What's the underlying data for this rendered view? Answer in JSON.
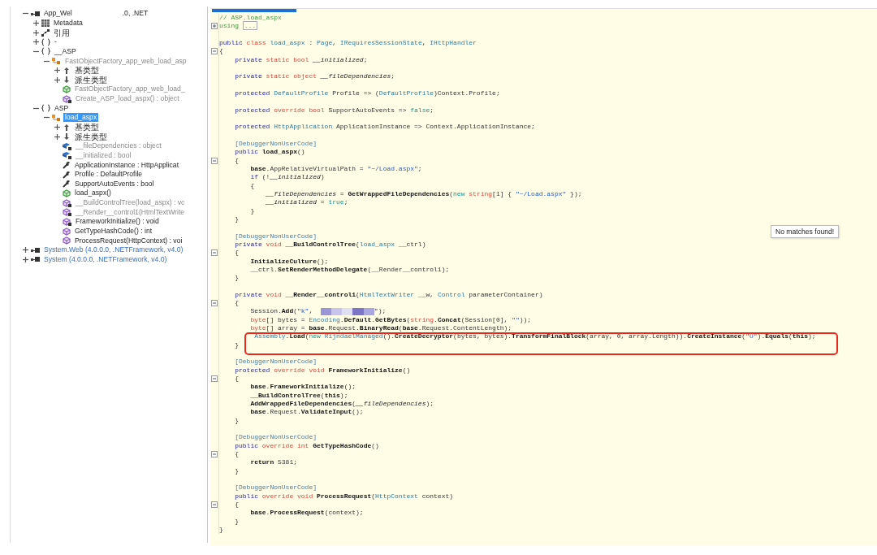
{
  "tree": [
    {
      "kind": "assembly",
      "label": "App_Wel",
      "tail": ".0, .NET",
      "dimmed": false,
      "expanded": true,
      "selected": false,
      "children": [
        {
          "kind": "metadata",
          "label": "Metadata",
          "dimmed": false,
          "expanded": false,
          "selected": false
        },
        {
          "kind": "references",
          "label": "引用",
          "dimmed": false,
          "expanded": false,
          "selected": false
        },
        {
          "kind": "namespace",
          "label": "-",
          "dimmed": false,
          "expanded": false,
          "selected": false
        },
        {
          "kind": "namespace",
          "label": "__ASP",
          "dimmed": false,
          "expanded": true,
          "selected": false,
          "children": [
            {
              "kind": "class",
              "label": "FastObjectFactory_app_web_load_asp",
              "dimmed": true,
              "expanded": true,
              "selected": false,
              "children": [
                {
                  "kind": "base-types",
                  "label": "基类型",
                  "dimmed": false,
                  "expanded": false,
                  "selected": false
                },
                {
                  "kind": "derived-types",
                  "label": "派生类型",
                  "dimmed": false,
                  "expanded": false,
                  "selected": false
                },
                {
                  "kind": "constructor",
                  "label": "FastObjectFactory_app_web_load_",
                  "dimmed": true,
                  "selected": false
                },
                {
                  "kind": "method-private",
                  "label": "Create_ASP_load_aspx() : object",
                  "dimmed": true,
                  "selected": false
                }
              ]
            }
          ]
        },
        {
          "kind": "namespace",
          "label": "ASP",
          "dimmed": false,
          "expanded": true,
          "selected": false,
          "children": [
            {
              "kind": "class",
              "label": "load_aspx",
              "dimmed": false,
              "expanded": true,
              "selected": true,
              "children": [
                {
                  "kind": "base-types",
                  "label": "基类型",
                  "dimmed": false,
                  "expanded": false,
                  "selected": false
                },
                {
                  "kind": "derived-types",
                  "label": "派生类型",
                  "dimmed": false,
                  "expanded": false,
                  "selected": false
                },
                {
                  "kind": "field",
                  "label": "__fileDependencies : object",
                  "dimmed": true,
                  "selected": false
                },
                {
                  "kind": "field",
                  "label": "__initialized : bool",
                  "dimmed": true,
                  "selected": false
                },
                {
                  "kind": "property",
                  "label": "ApplicationInstance : HttpApplicat",
                  "dimmed": false,
                  "selected": false
                },
                {
                  "kind": "property",
                  "label": "Profile : DefaultProfile",
                  "dimmed": false,
                  "selected": false
                },
                {
                  "kind": "property",
                  "label": "SupportAutoEvents : bool",
                  "dimmed": false,
                  "selected": false
                },
                {
                  "kind": "constructor",
                  "label": "load_aspx()",
                  "dimmed": false,
                  "selected": false
                },
                {
                  "kind": "method-private",
                  "label": "__BuildControlTree(load_aspx) : vc",
                  "dimmed": true,
                  "selected": false
                },
                {
                  "kind": "method-private",
                  "label": "__Render__control1(HtmlTextWrite",
                  "dimmed": true,
                  "selected": false
                },
                {
                  "kind": "method-protected",
                  "label": "FrameworkInitialize() : void",
                  "dimmed": false,
                  "selected": false
                },
                {
                  "kind": "method",
                  "label": "GetTypeHashCode() : int",
                  "dimmed": false,
                  "selected": false
                },
                {
                  "kind": "method",
                  "label": "ProcessRequest(HttpContext) : voi",
                  "dimmed": false,
                  "selected": false
                }
              ]
            }
          ]
        }
      ]
    },
    {
      "kind": "reference-assembly",
      "label": "System.Web (4.0.0.0, .NETFramework, v4.0)",
      "dimmed": false,
      "expanded": false,
      "selected": false
    },
    {
      "kind": "reference-assembly",
      "label": "System (4.0.0.0, .NETFramework, v4.0)",
      "dimmed": false,
      "expanded": false,
      "selected": false
    }
  ],
  "code": {
    "search_popup": "No matches found!",
    "lines": [
      {
        "boxed": false,
        "t": [
          {
            "kind": "comment",
            "text": "// ASP.load_aspx"
          }
        ]
      },
      {
        "boxed": false,
        "fold_expanded": false,
        "t": [
          {
            "kind": "comment",
            "text": "using "
          },
          {
            "kind": "collapsed",
            "text": "..."
          }
        ]
      },
      {
        "boxed": false
      },
      {
        "boxed": false,
        "t": [
          {
            "kind": "keyword",
            "text": "public"
          },
          {
            "kind": "modifier",
            "text": " class"
          },
          {
            "kind": "type",
            "text": " load_aspx"
          },
          {
            "kind": "plain",
            "text": " : "
          },
          {
            "kind": "type",
            "text": "Page"
          },
          {
            "kind": "plain",
            "text": ", "
          },
          {
            "kind": "type",
            "text": "IRequiresSessionState"
          },
          {
            "kind": "plain",
            "text": ", "
          },
          {
            "kind": "type",
            "text": "IHttpHandler"
          }
        ]
      },
      {
        "boxed": false,
        "fold_expanded": true,
        "t": [
          {
            "kind": "plain",
            "text": "{"
          }
        ]
      },
      {
        "boxed": false,
        "t": [
          {
            "kind": "keyword",
            "text": "private"
          },
          {
            "kind": "modifier",
            "text": " static bool"
          },
          {
            "kind": "field",
            "text": " __initialized"
          },
          {
            "kind": "plain",
            "text": ";"
          }
        ]
      },
      {
        "boxed": false
      },
      {
        "boxed": false,
        "t": [
          {
            "kind": "keyword",
            "text": "private"
          },
          {
            "kind": "modifier",
            "text": " static object"
          },
          {
            "kind": "field",
            "text": " __fileDependencies"
          },
          {
            "kind": "plain",
            "text": ";"
          }
        ]
      },
      {
        "boxed": false
      },
      {
        "boxed": false,
        "t": [
          {
            "kind": "keyword",
            "text": "protected"
          },
          {
            "kind": "type",
            "text": " DefaultProfile"
          },
          {
            "kind": "plain",
            "text": " Profile => ("
          },
          {
            "kind": "type",
            "text": "DefaultProfile"
          },
          {
            "kind": "plain",
            "text": ")Context.Profile;"
          }
        ]
      },
      {
        "boxed": false
      },
      {
        "boxed": false,
        "t": [
          {
            "kind": "keyword",
            "text": "protected"
          },
          {
            "kind": "modifier",
            "text": " override bool"
          },
          {
            "kind": "plain",
            "text": " SupportAutoEvents => "
          },
          {
            "kind": "literal",
            "text": "false"
          },
          {
            "kind": "plain",
            "text": ";"
          }
        ]
      },
      {
        "boxed": false
      },
      {
        "boxed": false,
        "t": [
          {
            "kind": "keyword",
            "text": "protected"
          },
          {
            "kind": "type",
            "text": " HttpApplication"
          },
          {
            "kind": "plain",
            "text": " ApplicationInstance => Context.ApplicationInstance;"
          }
        ]
      },
      {
        "boxed": false
      },
      {
        "boxed": false,
        "t": [
          {
            "kind": "attribute",
            "text": "[DebuggerNonUserCode]"
          }
        ]
      },
      {
        "boxed": false,
        "t": [
          {
            "kind": "keyword",
            "text": "public"
          },
          {
            "kind": "method",
            "text": " load_aspx"
          },
          {
            "kind": "plain",
            "text": "()"
          }
        ]
      },
      {
        "boxed": false,
        "fold_expanded": true,
        "t": [
          {
            "kind": "plain",
            "text": "{"
          }
        ]
      },
      {
        "boxed": false,
        "t": [
          {
            "kind": "method",
            "text": "base"
          },
          {
            "kind": "plain",
            "text": ".AppRelativeVirtualPath = "
          },
          {
            "kind": "string",
            "text": "\"~/Load.aspx\""
          },
          {
            "kind": "plain",
            "text": ";"
          }
        ]
      },
      {
        "boxed": false,
        "t": [
          {
            "kind": "keyword",
            "text": "if"
          },
          {
            "kind": "plain",
            "text": " (!"
          },
          {
            "kind": "field",
            "text": "__initialized"
          },
          {
            "kind": "plain",
            "text": ")"
          }
        ]
      },
      {
        "boxed": false,
        "t": [
          {
            "kind": "plain",
            "text": "{"
          }
        ]
      },
      {
        "boxed": false,
        "t": [
          {
            "kind": "field",
            "text": "__fileDependencies"
          },
          {
            "kind": "plain",
            "text": " = "
          },
          {
            "kind": "method",
            "text": "GetWrappedFileDependencies"
          },
          {
            "kind": "plain",
            "text": "("
          },
          {
            "kind": "literal",
            "text": "new"
          },
          {
            "kind": "modifier",
            "text": " string"
          },
          {
            "kind": "plain",
            "text": "[1] { "
          },
          {
            "kind": "string",
            "text": "\"~/Load.aspx\""
          },
          {
            "kind": "plain",
            "text": " });"
          }
        ]
      },
      {
        "boxed": false,
        "t": [
          {
            "kind": "field",
            "text": "__initialized"
          },
          {
            "kind": "plain",
            "text": " = "
          },
          {
            "kind": "literal",
            "text": "true"
          },
          {
            "kind": "plain",
            "text": ";"
          }
        ]
      },
      {
        "boxed": false,
        "t": [
          {
            "kind": "plain",
            "text": "}"
          }
        ]
      },
      {
        "boxed": false,
        "t": [
          {
            "kind": "plain",
            "text": "}"
          }
        ]
      },
      {
        "boxed": false
      },
      {
        "boxed": false,
        "t": [
          {
            "kind": "attribute",
            "text": "[DebuggerNonUserCode]"
          }
        ]
      },
      {
        "boxed": false,
        "t": [
          {
            "kind": "keyword",
            "text": "private"
          },
          {
            "kind": "modifier",
            "text": " void"
          },
          {
            "kind": "method",
            "text": " __BuildControlTree"
          },
          {
            "kind": "plain",
            "text": "("
          },
          {
            "kind": "type",
            "text": "load_aspx"
          },
          {
            "kind": "plain",
            "text": " __ctrl)"
          }
        ]
      },
      {
        "boxed": false,
        "fold_expanded": true,
        "t": [
          {
            "kind": "plain",
            "text": "{"
          }
        ]
      },
      {
        "boxed": false,
        "t": [
          {
            "kind": "method",
            "text": "InitializeCulture"
          },
          {
            "kind": "plain",
            "text": "();"
          }
        ]
      },
      {
        "boxed": false,
        "t": [
          {
            "kind": "plain",
            "text": "__ctrl."
          },
          {
            "kind": "method",
            "text": "SetRenderMethodDelegate"
          },
          {
            "kind": "plain",
            "text": "(__Render__control1);"
          }
        ]
      },
      {
        "boxed": false,
        "t": [
          {
            "kind": "plain",
            "text": "}"
          }
        ]
      },
      {
        "boxed": false
      },
      {
        "boxed": false,
        "t": [
          {
            "kind": "keyword",
            "text": "private"
          },
          {
            "kind": "modifier",
            "text": " void"
          },
          {
            "kind": "method",
            "text": " __Render__control1"
          },
          {
            "kind": "plain",
            "text": "("
          },
          {
            "kind": "type",
            "text": "HtmlTextWriter"
          },
          {
            "kind": "plain",
            "text": " __w, "
          },
          {
            "kind": "type",
            "text": "Control"
          },
          {
            "kind": "plain",
            "text": " parameterContainer)"
          }
        ]
      },
      {
        "boxed": false,
        "fold_expanded": true,
        "t": [
          {
            "kind": "plain",
            "text": "{"
          }
        ]
      },
      {
        "boxed": false,
        "t": [
          {
            "kind": "plain",
            "text": "Session."
          },
          {
            "kind": "method",
            "text": "Add"
          },
          {
            "kind": "plain",
            "text": "("
          },
          {
            "kind": "string",
            "text": "\"k\""
          },
          {
            "kind": "plain",
            "text": ",  "
          },
          {
            "kind": "redacted"
          },
          {
            "kind": "plain",
            "text": "\");"
          }
        ]
      },
      {
        "boxed": false,
        "t": [
          {
            "kind": "modifier",
            "text": "byte"
          },
          {
            "kind": "plain",
            "text": "[] bytes = "
          },
          {
            "kind": "type",
            "text": "Encoding"
          },
          {
            "kind": "plain",
            "text": "."
          },
          {
            "kind": "method",
            "text": "Default"
          },
          {
            "kind": "plain",
            "text": "."
          },
          {
            "kind": "method",
            "text": "GetBytes"
          },
          {
            "kind": "plain",
            "text": "("
          },
          {
            "kind": "modifier",
            "text": "string"
          },
          {
            "kind": "plain",
            "text": "."
          },
          {
            "kind": "method",
            "text": "Concat"
          },
          {
            "kind": "plain",
            "text": "(Session[0], "
          },
          {
            "kind": "string",
            "text": "\"\""
          },
          {
            "kind": "plain",
            "text": "));"
          }
        ]
      },
      {
        "boxed": false,
        "t": [
          {
            "kind": "modifier",
            "text": "byte"
          },
          {
            "kind": "plain",
            "text": "[] array = "
          },
          {
            "kind": "method",
            "text": "base"
          },
          {
            "kind": "plain",
            "text": ".Request."
          },
          {
            "kind": "method",
            "text": "BinaryRead"
          },
          {
            "kind": "plain",
            "text": "("
          },
          {
            "kind": "method",
            "text": "base"
          },
          {
            "kind": "plain",
            "text": ".Request.ContentLength);"
          }
        ]
      },
      {
        "boxed": true,
        "t": [
          {
            "kind": "type",
            "text": "Assembly"
          },
          {
            "kind": "plain",
            "text": "."
          },
          {
            "kind": "method",
            "text": "Load"
          },
          {
            "kind": "plain",
            "text": "("
          },
          {
            "kind": "literal",
            "text": "new"
          },
          {
            "kind": "type",
            "text": " RijndaelManaged"
          },
          {
            "kind": "plain",
            "text": "()."
          },
          {
            "kind": "method",
            "text": "CreateDecryptor"
          },
          {
            "kind": "plain",
            "text": "(bytes, bytes)."
          },
          {
            "kind": "method",
            "text": "TransformFinalBlock"
          },
          {
            "kind": "plain",
            "text": "(array, 0, array.Length))."
          },
          {
            "kind": "method",
            "text": "CreateInstance"
          },
          {
            "kind": "plain",
            "text": "("
          },
          {
            "kind": "string",
            "text": "\"U\""
          },
          {
            "kind": "plain",
            "text": ")."
          },
          {
            "kind": "method",
            "text": "Equals"
          },
          {
            "kind": "plain",
            "text": "("
          },
          {
            "kind": "method",
            "text": "this"
          },
          {
            "kind": "plain",
            "text": ");"
          }
        ]
      },
      {
        "boxed": false,
        "t": [
          {
            "kind": "plain",
            "text": "}"
          }
        ]
      },
      {
        "boxed": false
      },
      {
        "boxed": false,
        "t": [
          {
            "kind": "attribute",
            "text": "[DebuggerNonUserCode]"
          }
        ]
      },
      {
        "boxed": false,
        "t": [
          {
            "kind": "keyword",
            "text": "protected"
          },
          {
            "kind": "modifier",
            "text": " override void"
          },
          {
            "kind": "method",
            "text": " FrameworkInitialize"
          },
          {
            "kind": "plain",
            "text": "()"
          }
        ]
      },
      {
        "boxed": false,
        "fold_expanded": true,
        "t": [
          {
            "kind": "plain",
            "text": "{"
          }
        ]
      },
      {
        "boxed": false,
        "t": [
          {
            "kind": "method",
            "text": "base"
          },
          {
            "kind": "plain",
            "text": "."
          },
          {
            "kind": "method",
            "text": "FrameworkInitialize"
          },
          {
            "kind": "plain",
            "text": "();"
          }
        ]
      },
      {
        "boxed": false,
        "t": [
          {
            "kind": "method",
            "text": "__BuildControlTree"
          },
          {
            "kind": "plain",
            "text": "("
          },
          {
            "kind": "method",
            "text": "this"
          },
          {
            "kind": "plain",
            "text": ");"
          }
        ]
      },
      {
        "boxed": false,
        "t": [
          {
            "kind": "method",
            "text": "AddWrappedFileDependencies"
          },
          {
            "kind": "plain",
            "text": "("
          },
          {
            "kind": "field",
            "text": "__fileDependencies"
          },
          {
            "kind": "plain",
            "text": ");"
          }
        ]
      },
      {
        "boxed": false,
        "t": [
          {
            "kind": "method",
            "text": "base"
          },
          {
            "kind": "plain",
            "text": ".Request."
          },
          {
            "kind": "method",
            "text": "ValidateInput"
          },
          {
            "kind": "plain",
            "text": "();"
          }
        ]
      },
      {
        "boxed": false,
        "t": [
          {
            "kind": "plain",
            "text": "}"
          }
        ]
      },
      {
        "boxed": false
      },
      {
        "boxed": false,
        "t": [
          {
            "kind": "attribute",
            "text": "[DebuggerNonUserCode]"
          }
        ]
      },
      {
        "boxed": false,
        "t": [
          {
            "kind": "keyword",
            "text": "public"
          },
          {
            "kind": "modifier",
            "text": " override int"
          },
          {
            "kind": "method",
            "text": " GetTypeHashCode"
          },
          {
            "kind": "plain",
            "text": "()"
          }
        ]
      },
      {
        "boxed": false,
        "fold_expanded": true,
        "t": [
          {
            "kind": "plain",
            "text": "{"
          }
        ]
      },
      {
        "boxed": false,
        "t": [
          {
            "kind": "method",
            "text": "return"
          },
          {
            "kind": "plain",
            "text": " 5381;"
          }
        ]
      },
      {
        "boxed": false,
        "t": [
          {
            "kind": "plain",
            "text": "}"
          }
        ]
      },
      {
        "boxed": false
      },
      {
        "boxed": false,
        "t": [
          {
            "kind": "attribute",
            "text": "[DebuggerNonUserCode]"
          }
        ]
      },
      {
        "boxed": false,
        "t": [
          {
            "kind": "keyword",
            "text": "public"
          },
          {
            "kind": "modifier",
            "text": " override void"
          },
          {
            "kind": "method",
            "text": " ProcessRequest"
          },
          {
            "kind": "plain",
            "text": "("
          },
          {
            "kind": "type",
            "text": "HttpContext"
          },
          {
            "kind": "plain",
            "text": " context)"
          }
        ]
      },
      {
        "boxed": false,
        "fold_expanded": true,
        "t": [
          {
            "kind": "plain",
            "text": "{"
          }
        ]
      },
      {
        "boxed": false,
        "t": [
          {
            "kind": "method",
            "text": "base"
          },
          {
            "kind": "plain",
            "text": "."
          },
          {
            "kind": "method",
            "text": "ProcessRequest"
          },
          {
            "kind": "plain",
            "text": "(context);"
          }
        ]
      },
      {
        "boxed": false,
        "t": [
          {
            "kind": "plain",
            "text": "}"
          }
        ]
      },
      {
        "boxed": false,
        "t": [
          {
            "kind": "plain",
            "text": "}"
          }
        ]
      }
    ]
  }
}
